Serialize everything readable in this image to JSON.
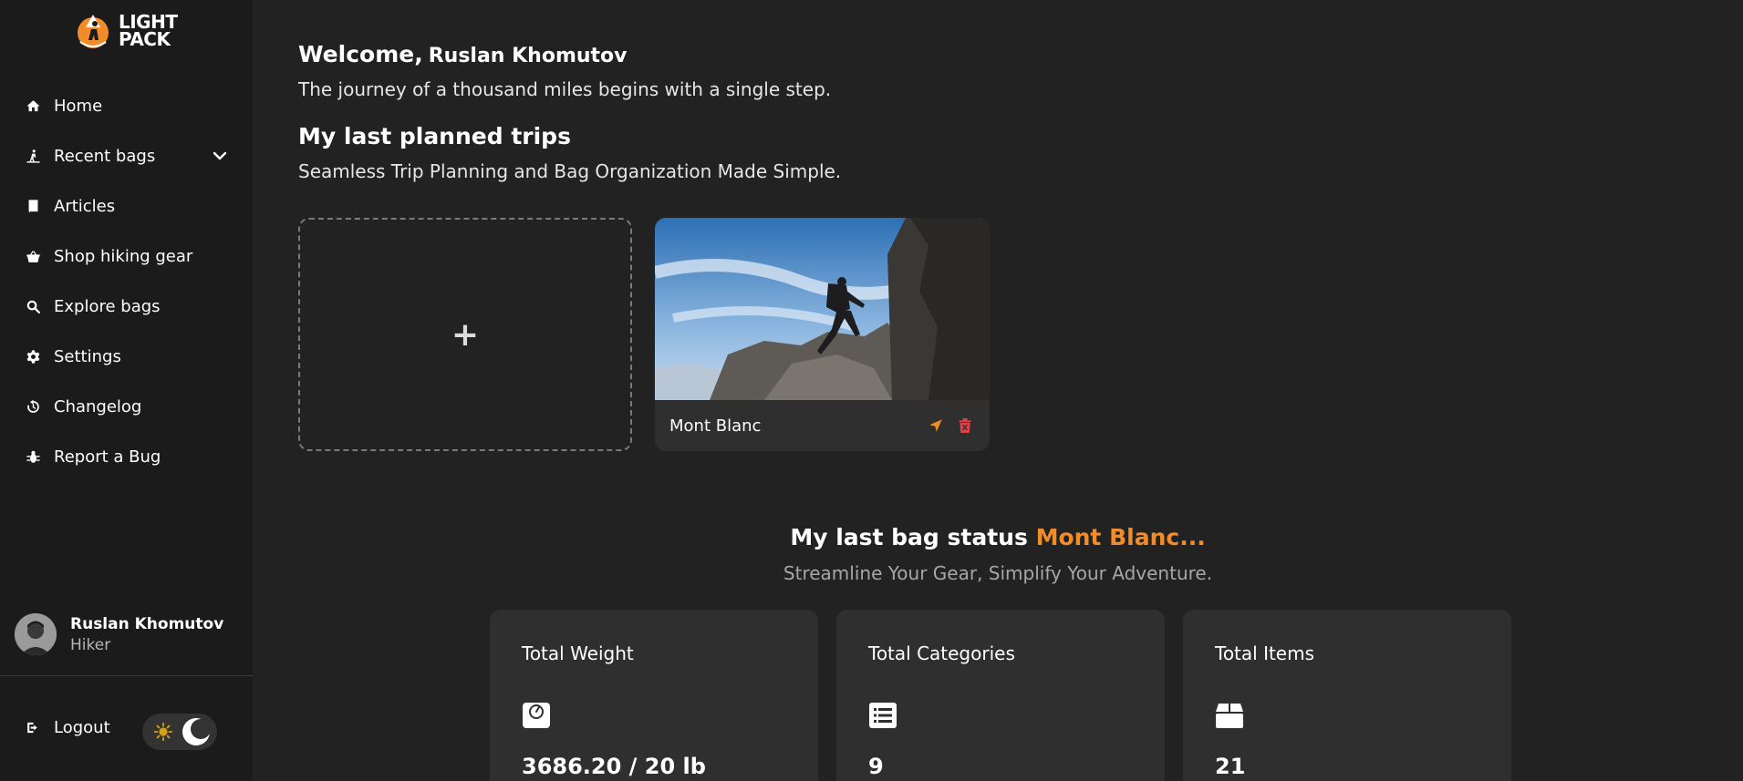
{
  "brand": {
    "line1": "LIGHT",
    "line2": "PACK",
    "accent": "#f28c28"
  },
  "sidebar": {
    "items": [
      {
        "label": "Home",
        "icon": "home-icon"
      },
      {
        "label": "Recent bags",
        "icon": "hiker-icon"
      },
      {
        "label": "Articles",
        "icon": "book-icon"
      },
      {
        "label": "Shop hiking gear",
        "icon": "basket-icon"
      },
      {
        "label": "Explore bags",
        "icon": "search-icon"
      },
      {
        "label": "Settings",
        "icon": "gear-icon"
      },
      {
        "label": "Changelog",
        "icon": "history-icon"
      },
      {
        "label": "Report a Bug",
        "icon": "bug-icon"
      }
    ],
    "user": {
      "name": "Ruslan Khomutov",
      "role": "Hiker"
    },
    "logout_label": "Logout"
  },
  "main": {
    "welcome_prefix": "Welcome,",
    "welcome_name": "Ruslan Khomutov",
    "welcome_sub": "The journey of a thousand miles begins with a single step.",
    "trips_title": "My last planned trips",
    "trips_sub": "Seamless Trip Planning and Bag Organization Made Simple.",
    "add_symbol": "+",
    "trip": {
      "title": "Mont Blanc"
    },
    "status_prefix": "My last bag status",
    "status_bag": "Mont Blanc...",
    "status_sub": "Streamline Your Gear, Simplify Your Adventure.",
    "stats": [
      {
        "label": "Total Weight",
        "value": "3686.20 / 20 lb",
        "icon": "scale-icon"
      },
      {
        "label": "Total Categories",
        "value": "9",
        "icon": "list-icon"
      },
      {
        "label": "Total Items",
        "value": "21",
        "icon": "box-icon"
      }
    ]
  }
}
